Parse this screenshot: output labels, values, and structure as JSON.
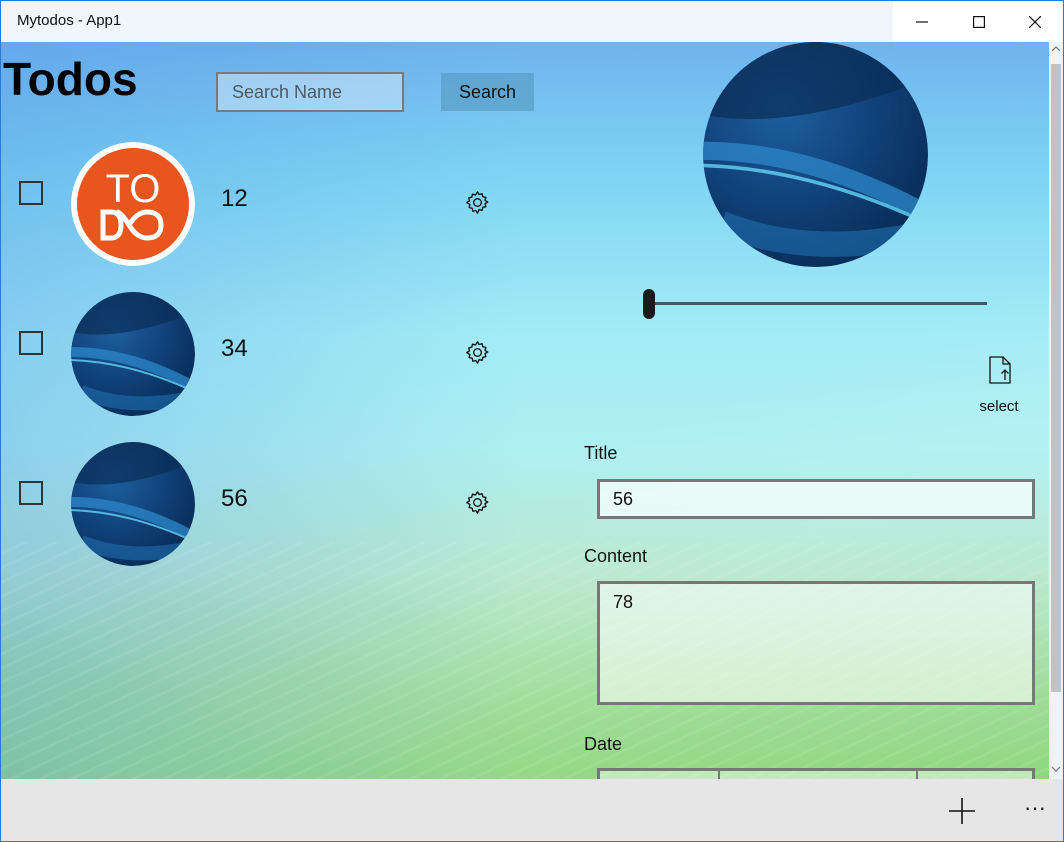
{
  "window": {
    "title": "Mytodos - App1",
    "controls": {
      "minimize_icon": "minimize-icon",
      "maximize_icon": "maximize-icon",
      "close_icon": "close-icon"
    }
  },
  "header": {
    "page_title": "Todos",
    "search_placeholder": "Search Name",
    "search_value": "",
    "search_button": "Search"
  },
  "todos": [
    {
      "title": "12",
      "checked": false,
      "avatar": "todo-logo",
      "action_icon": "gear-icon"
    },
    {
      "title": "34",
      "checked": false,
      "avatar": "blue-abstract",
      "action_icon": "gear-icon"
    },
    {
      "title": "56",
      "checked": false,
      "avatar": "blue-abstract",
      "action_icon": "gear-icon"
    }
  ],
  "logo": {
    "text_top": "TO",
    "color": "#e8561e"
  },
  "editor": {
    "slider_value": 0,
    "select_label": "select",
    "select_icon": "file-upload-icon",
    "title_label": "Title",
    "title_value": "56",
    "content_label": "Content",
    "content_value": "78",
    "date_label": "Date"
  },
  "command_bar": {
    "add_icon": "add-icon",
    "more_label": "···"
  },
  "colors": {
    "accent": "#2b79d6",
    "logo_orange": "#e8561e",
    "command_bar": "#e6e6e6"
  }
}
